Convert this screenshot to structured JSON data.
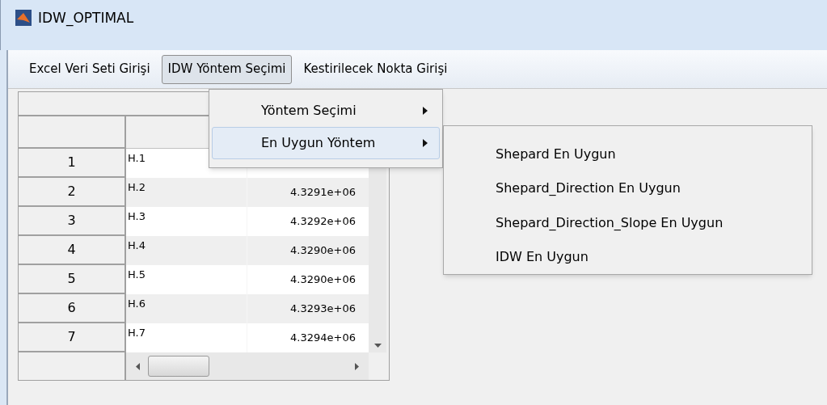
{
  "window": {
    "title": "IDW_OPTIMAL"
  },
  "menu_bar": [
    {
      "label": "Excel Veri Seti Girişi",
      "selected": false
    },
    {
      "label": "IDW Yöntem Seçimi",
      "selected": true
    },
    {
      "label": "Kestirilecek Nokta Girişi",
      "selected": false
    }
  ],
  "dropdown": [
    {
      "label": "Yöntem Seçimi",
      "selected": false
    },
    {
      "label": "En Uygun Yöntem",
      "selected": true
    }
  ],
  "submenu": [
    "Shepard En Uygun",
    "Shepard_Direction En Uygun",
    "Shepard_Direction_Slope En Uygun",
    "IDW En Uygun"
  ],
  "table": {
    "rows": [
      {
        "number": "1",
        "name": "H.1"
      },
      {
        "number": "2",
        "name": "H.2",
        "value": "4.3291e+06"
      },
      {
        "number": "3",
        "name": "H.3",
        "value": "4.3292e+06"
      },
      {
        "number": "4",
        "name": "H.4",
        "value": "4.3290e+06"
      },
      {
        "number": "5",
        "name": "H.5",
        "value": "4.3290e+06"
      },
      {
        "number": "6",
        "name": "H.6",
        "value": "4.3293e+06"
      },
      {
        "number": "7",
        "name": "H.7",
        "value": "4.3294e+06"
      }
    ]
  }
}
